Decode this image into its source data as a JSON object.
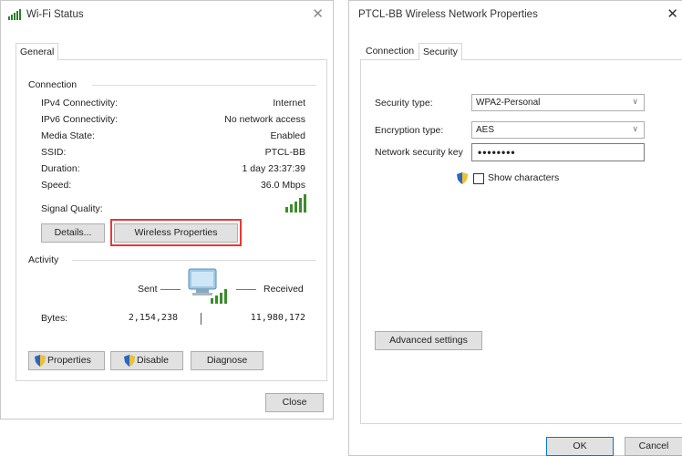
{
  "wifi_status": {
    "title": "Wi-Fi Status",
    "tab": "General",
    "connection": {
      "heading": "Connection",
      "rows": [
        {
          "label": "IPv4 Connectivity:",
          "value": "Internet"
        },
        {
          "label": "IPv6 Connectivity:",
          "value": "No network access"
        },
        {
          "label": "Media State:",
          "value": "Enabled"
        },
        {
          "label": "SSID:",
          "value": "PTCL-BB"
        },
        {
          "label": "Duration:",
          "value": "1 day 23:37:39"
        },
        {
          "label": "Speed:",
          "value": "36.0 Mbps"
        }
      ],
      "signal_label": "Signal Quality:"
    },
    "details_label": "Details...",
    "wireless_properties_label": "Wireless Properties",
    "activity": {
      "heading": "Activity",
      "sent_label": "Sent",
      "received_label": "Received",
      "bytes_label": "Bytes:",
      "bytes_sent": "2,154,238",
      "bytes_received": "11,980,172"
    },
    "properties_label": "Properties",
    "disable_label": "Disable",
    "diagnose_label": "Diagnose",
    "close_label": "Close"
  },
  "network_properties": {
    "title": "PTCL-BB Wireless Network Properties",
    "tabs": [
      "Connection",
      "Security"
    ],
    "security_type_label": "Security type:",
    "security_type_value": "WPA2-Personal",
    "encryption_type_label": "Encryption type:",
    "encryption_type_value": "AES",
    "network_key_label": "Network security key",
    "network_key_value": "••••••••",
    "show_characters_label": "Show characters",
    "advanced_settings_label": "Advanced settings",
    "ok_label": "OK",
    "cancel_label": "Cancel"
  },
  "colors": {
    "highlight": "#e53935",
    "accent": "#0078d7",
    "signal": "#3c8c2c"
  }
}
